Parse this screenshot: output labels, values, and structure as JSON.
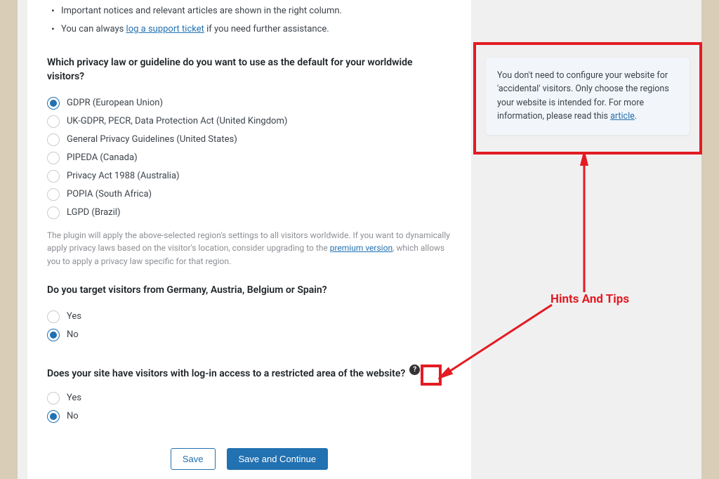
{
  "info_list": {
    "item1_text": "Important notices and relevant articles are shown in the right column.",
    "item2_pre": "You can always ",
    "item2_link": "log a support ticket",
    "item2_post": " if you need further assistance."
  },
  "q1": {
    "title": "Which privacy law or guideline do you want to use as the default for your worldwide visitors?",
    "options": [
      {
        "label": "GDPR (European Union)",
        "selected": true
      },
      {
        "label": "UK-GDPR, PECR, Data Protection Act (United Kingdom)",
        "selected": false
      },
      {
        "label": "General Privacy Guidelines (United States)",
        "selected": false
      },
      {
        "label": "PIPEDA (Canada)",
        "selected": false
      },
      {
        "label": "Privacy Act 1988 (Australia)",
        "selected": false
      },
      {
        "label": "POPIA (South Africa)",
        "selected": false
      },
      {
        "label": "LGPD (Brazil)",
        "selected": false
      }
    ],
    "note_pre": "The plugin will apply the above-selected region's settings to all visitors worldwide. If you want to dynamically apply privacy laws based on the visitor's location, consider upgrading to the ",
    "note_link": "premium version",
    "note_post": ", which allows you to apply a privacy law specific for that region."
  },
  "q2": {
    "title": "Do you target visitors from Germany, Austria, Belgium or Spain?",
    "options": [
      {
        "label": "Yes",
        "selected": false
      },
      {
        "label": "No",
        "selected": true
      }
    ]
  },
  "q3": {
    "title": "Does your site have visitors with log-in access to a restricted area of the website?",
    "options": [
      {
        "label": "Yes",
        "selected": false
      },
      {
        "label": "No",
        "selected": true
      }
    ]
  },
  "buttons": {
    "save": "Save",
    "save_continue": "Save and Continue"
  },
  "tip": {
    "text_pre": "You don't need to configure your website for 'accidental' visitors. Only choose the regions your website is intended for. For more information, please read this ",
    "link": "article",
    "text_post": "."
  },
  "annotation": {
    "label": "Hints And Tips",
    "help_icon": "?"
  },
  "colors": {
    "accent": "#2271b1",
    "annotation": "#e31b23"
  }
}
